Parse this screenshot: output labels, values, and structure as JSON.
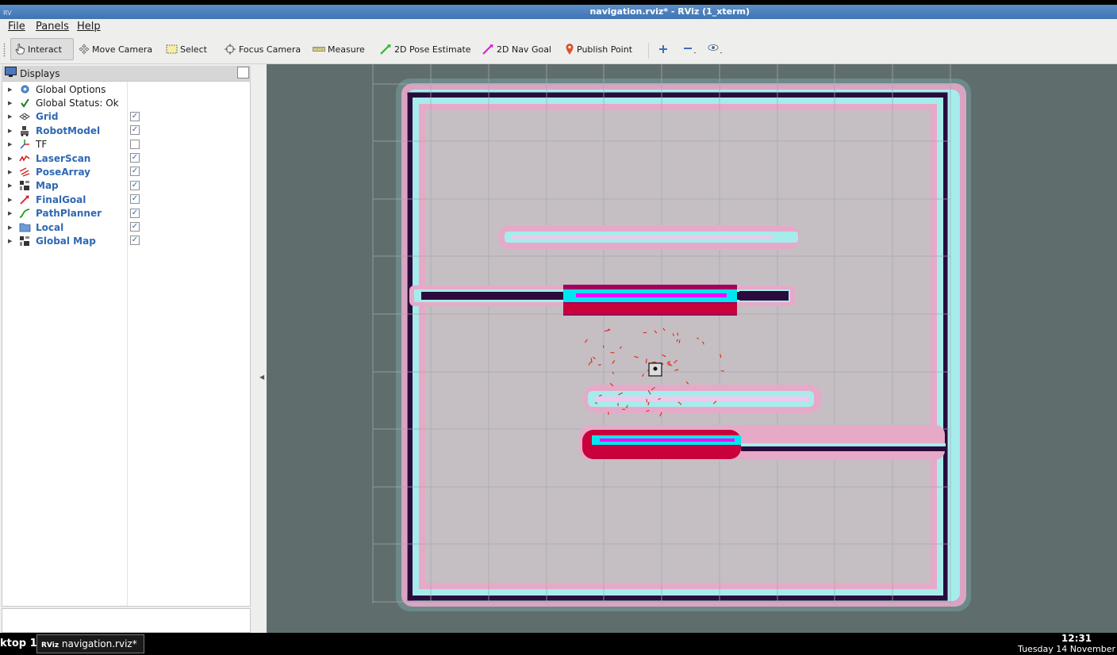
{
  "window": {
    "title": "navigation.rviz* - RViz (1_xterm)",
    "icon_label": "RV"
  },
  "menu": {
    "file": "File",
    "panels": "Panels",
    "help": "Help"
  },
  "toolbar": {
    "interact": "Interact",
    "move_camera": "Move Camera",
    "select": "Select",
    "focus_camera": "Focus Camera",
    "measure": "Measure",
    "pose_estimate": "2D Pose Estimate",
    "nav_goal": "2D Nav Goal",
    "publish_point": "Publish Point"
  },
  "displays": {
    "title": "Displays",
    "items": [
      {
        "label": "Global Options",
        "icon": "gear-icon",
        "plugin": false,
        "checked": null
      },
      {
        "label": "Global Status: Ok",
        "icon": "check-icon",
        "plugin": false,
        "checked": null
      },
      {
        "label": "Grid",
        "icon": "grid-icon",
        "plugin": true,
        "checked": true
      },
      {
        "label": "RobotModel",
        "icon": "robot-icon",
        "plugin": true,
        "checked": true
      },
      {
        "label": "TF",
        "icon": "axes-icon",
        "plugin": false,
        "checked": false
      },
      {
        "label": "LaserScan",
        "icon": "laser-icon",
        "plugin": true,
        "checked": true
      },
      {
        "label": "PoseArray",
        "icon": "pose-array-icon",
        "plugin": true,
        "checked": true
      },
      {
        "label": "Map",
        "icon": "map-icon",
        "plugin": true,
        "checked": true
      },
      {
        "label": "FinalGoal",
        "icon": "arrow-icon",
        "plugin": true,
        "checked": true
      },
      {
        "label": "PathPlanner",
        "icon": "path-icon",
        "plugin": true,
        "checked": true
      },
      {
        "label": "Local",
        "icon": "folder-icon",
        "plugin": true,
        "checked": true
      },
      {
        "label": "Global Map",
        "icon": "map-icon",
        "plugin": true,
        "checked": true
      }
    ]
  },
  "colors": {
    "viewport_bg": "#5f6e6c",
    "free_space": "#c5bfc4",
    "inflation_pink": "#e6aac8",
    "inflation_cyan": "#a6ecec",
    "obstacle": "#2a0b3c",
    "lethal_red": "#c8003c",
    "magenta": "#ff00ff",
    "cyan": "#00f0f0",
    "particles": "#e0321e"
  },
  "taskbar": {
    "desktop": "ktop 1",
    "task": "navigation.rviz* -...",
    "task_icon": "RViz",
    "time": "12:31",
    "date": "Tuesday 14 November"
  }
}
